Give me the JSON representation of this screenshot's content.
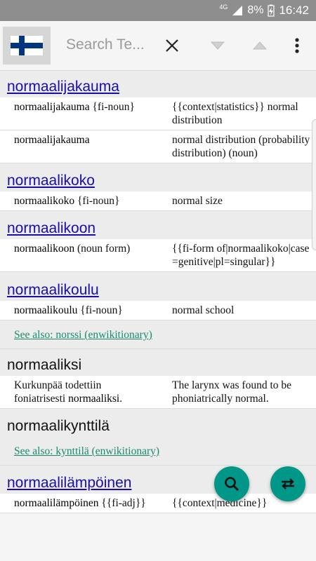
{
  "status_bar": {
    "network": "4G",
    "battery": "8%",
    "time": "16:42"
  },
  "toolbar": {
    "search_placeholder": "Search Te..."
  },
  "entries": [
    {
      "title": "normaalijakauma",
      "link": true,
      "rows": [
        {
          "left_hw": "normaalijakauma",
          "left_rest": " {fi-noun}",
          "right": "{{context|statistics}} normal distribution"
        },
        {
          "left_hw": "normaalijakauma",
          "left_rest": "",
          "right": "normal distribution (probability distribution) (noun)"
        }
      ]
    },
    {
      "title": "normaalikoko",
      "link": true,
      "rows": [
        {
          "left_hw": "normaalikoko",
          "left_rest": " {fi-noun}",
          "right": "normal size"
        }
      ]
    },
    {
      "title": "normaalikoon",
      "link": true,
      "rows": [
        {
          "left_hw": "normaalikoon",
          "left_rest": " (noun form)",
          "right": "{{fi-form of|normaalikoko|case=genitive|pl=singular}}"
        }
      ]
    },
    {
      "title": "normaalikoulu",
      "link": true,
      "rows": [
        {
          "left_hw": "normaalikoulu",
          "left_rest": " {fi-noun}",
          "right": "normal school"
        }
      ],
      "see_also": "See also: norssi (enwikitionary)"
    },
    {
      "title": "normaaliksi",
      "link": false,
      "rows": [
        {
          "left_pre": "Kurkunpää todettiin foniatrisesti ",
          "left_hw": "normaaliksi",
          "left_rest": ".",
          "right": "The larynx was found to be phoniatrically normal."
        }
      ]
    },
    {
      "title": "normaalikynttilä",
      "link": false,
      "rows": [],
      "see_also": "See also: kynttilä (enwikitionary)"
    },
    {
      "title": "normaalilämpöinen",
      "link": true,
      "rows": [
        {
          "left_hw": "normaalilämpöinen",
          "left_rest": " {{fi-adj}}",
          "right": "{{context|medicine}}"
        }
      ]
    }
  ]
}
